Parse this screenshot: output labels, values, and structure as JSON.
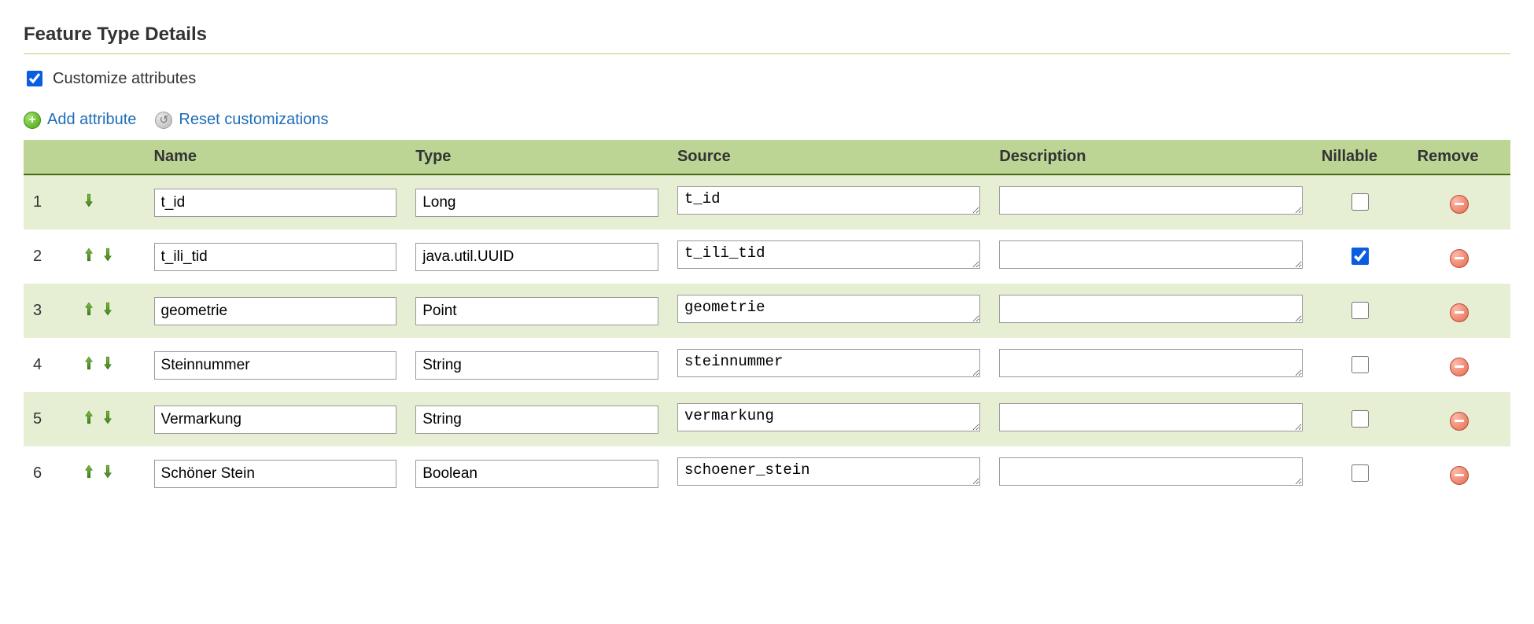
{
  "section_title": "Feature Type Details",
  "customize_checkbox": {
    "label": "Customize attributes",
    "checked": true
  },
  "actions": {
    "add_attribute": "Add attribute",
    "reset_customizations": "Reset customizations"
  },
  "table": {
    "headers": {
      "name": "Name",
      "type": "Type",
      "source": "Source",
      "description": "Description",
      "nillable": "Nillable",
      "remove": "Remove"
    },
    "rows": [
      {
        "index": "1",
        "show_up": false,
        "show_down": true,
        "name": "t_id",
        "type": "Long",
        "source": "t_id",
        "description": "",
        "nillable": false
      },
      {
        "index": "2",
        "show_up": true,
        "show_down": true,
        "name": "t_ili_tid",
        "type": "java.util.UUID",
        "source": "t_ili_tid",
        "description": "",
        "nillable": true
      },
      {
        "index": "3",
        "show_up": true,
        "show_down": true,
        "name": "geometrie",
        "type": "Point",
        "source": "geometrie",
        "description": "",
        "nillable": false
      },
      {
        "index": "4",
        "show_up": true,
        "show_down": true,
        "name": "Steinnummer",
        "type": "String",
        "source": "steinnummer",
        "description": "",
        "nillable": false
      },
      {
        "index": "5",
        "show_up": true,
        "show_down": true,
        "name": "Vermarkung",
        "type": "String",
        "source": "vermarkung",
        "description": "",
        "nillable": false
      },
      {
        "index": "6",
        "show_up": true,
        "show_down": true,
        "name": "Schöner Stein",
        "type": "Boolean",
        "source": "schoener_stein",
        "description": "",
        "nillable": false
      }
    ]
  }
}
